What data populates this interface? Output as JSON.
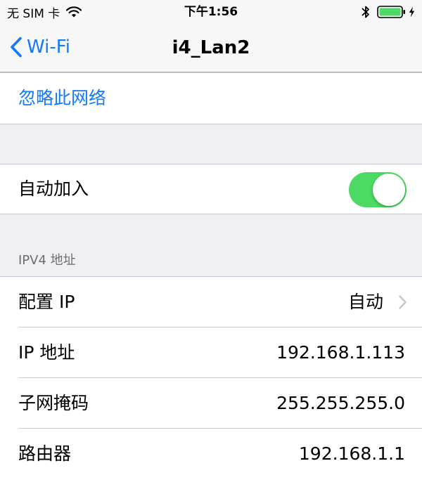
{
  "status_bar": {
    "carrier": "无 SIM 卡",
    "time": "下午1:56",
    "icons": [
      "wifi-icon",
      "bluetooth-icon",
      "battery-icon",
      "charging-bolt-icon"
    ],
    "battery_color": "#4cd964"
  },
  "nav": {
    "back_label": "Wi-Fi",
    "title": "i4_Lan2",
    "accent_color": "#127afb"
  },
  "forget": {
    "label": "忽略此网络"
  },
  "auto_join": {
    "label": "自动加入",
    "enabled": true,
    "toggle_color": "#4cd964"
  },
  "ipv4": {
    "header": "IPV4 地址",
    "rows": [
      {
        "label": "配置 IP",
        "value": "自动",
        "has_chevron": true
      },
      {
        "label": "IP 地址",
        "value": "192.168.1.113"
      },
      {
        "label": "子网掩码",
        "value": "255.255.255.0"
      },
      {
        "label": "路由器",
        "value": "192.168.1.1"
      }
    ]
  }
}
